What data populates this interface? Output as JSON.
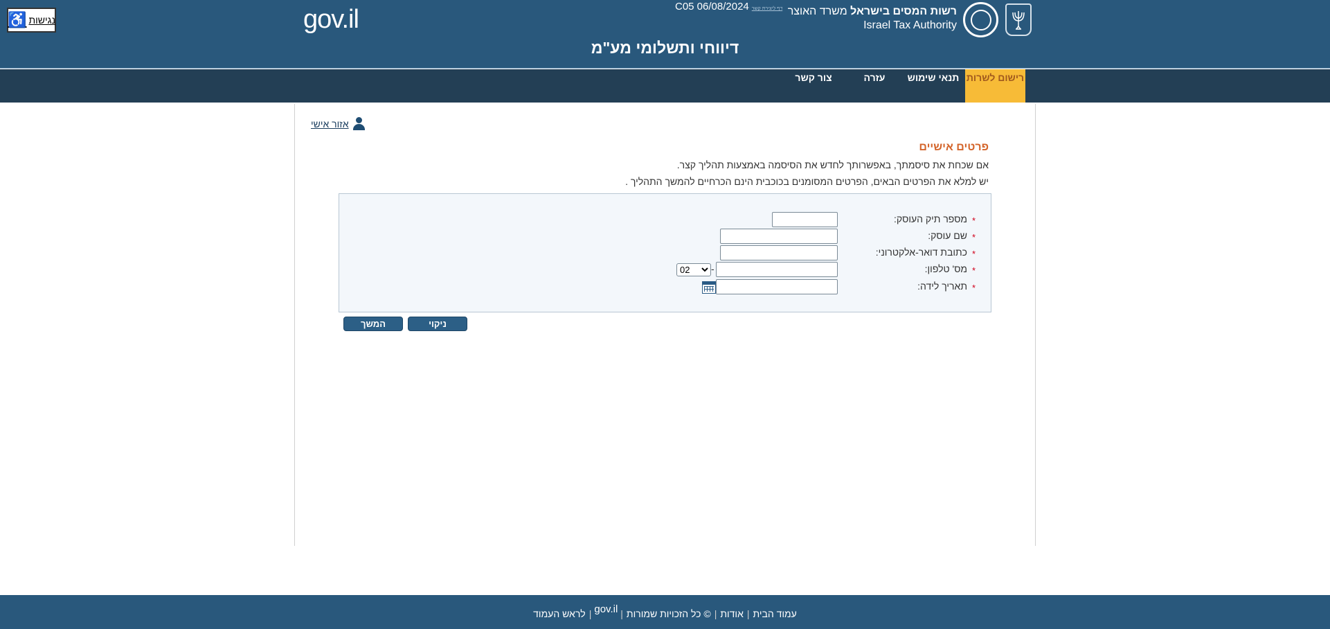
{
  "accessibility": {
    "label": "נגישות"
  },
  "header": {
    "govil_logo": "gov.il",
    "date_text": "C05 06/08/2024",
    "tiny_link": "דף ליצירת קשר",
    "tax_authority_he_bold": "רשות המסים בישראל",
    "tax_authority_he_regular": "משרד האוצר",
    "tax_authority_en": "Israel Tax Authority",
    "seal_text": "רשות המסים בישראל",
    "page_title": "דיווחי ותשלומי מע\"מ"
  },
  "nav": {
    "items": [
      {
        "label": "רישום לשרות",
        "active": true
      },
      {
        "label": "תנאי שימוש",
        "active": false
      },
      {
        "label": "עזרה",
        "active": false
      },
      {
        "label": "צור קשר",
        "active": false
      }
    ]
  },
  "personal_area": {
    "label": "אזור אישי"
  },
  "section": {
    "title": "פרטים אישיים",
    "intro1": "אם שכחת את סיסמתך, באפשרותך לחדש את הסיסמה באמצעות תהליך קצר.",
    "intro2": "יש למלא את הפרטים הבאים, הפרטים המסומנים בכוכבית הינם הכרחיים להמשך התהליך ."
  },
  "form": {
    "required_mark": "*",
    "fields": [
      {
        "label": "מספר תיק העוסק:",
        "value": ""
      },
      {
        "label": "שם עוסק:",
        "value": ""
      },
      {
        "label": "כתובת דואר-אלקטרוני:",
        "value": ""
      },
      {
        "label": "מס' טלפון:",
        "value": "",
        "prefix": "02",
        "separator": "-"
      },
      {
        "label": "תאריך לידה:",
        "value": ""
      }
    ]
  },
  "buttons": {
    "clear": "ניקוי",
    "continue": "המשך"
  },
  "footer": {
    "home": "עמוד הבית",
    "about": "אודות",
    "rights": "© כל הזכויות שמורות",
    "gov": "gov.il",
    "top": "לראש העמוד",
    "sep": "|"
  },
  "colors": {
    "header_bg": "#29587c",
    "nav_bg": "#233f55",
    "nav_active": "#f7bb37",
    "section_title": "#d4652b",
    "button": "#2c5f86"
  }
}
